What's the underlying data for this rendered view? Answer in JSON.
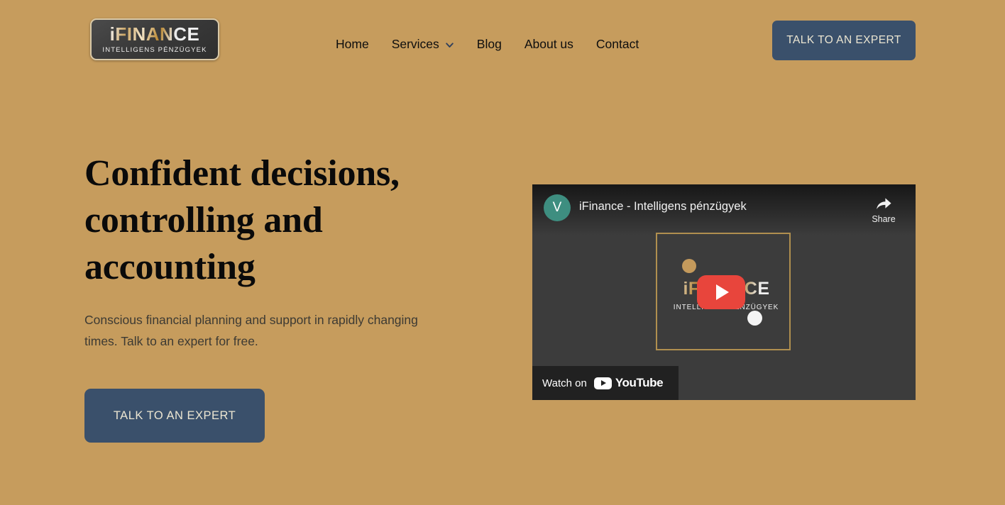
{
  "theme": {
    "background": "#c69c5d",
    "accent_navy": "#3a506b",
    "button_text": "#ece6d2",
    "heading_color": "#0a0a0a",
    "body_text": "#3d3a33",
    "youtube_red": "#e8453c",
    "avatar_teal": "#3e8e80",
    "player_bg": "#3c3c3c",
    "logo_gold": "#b88b3f"
  },
  "header": {
    "logo": {
      "main": "iFINANCE",
      "sub": "INTELLIGENS PÉNZÜGYEK"
    },
    "nav": [
      {
        "label": "Home",
        "has_dropdown": false
      },
      {
        "label": "Services",
        "has_dropdown": true,
        "icon": "chevron-down-icon"
      },
      {
        "label": "Blog",
        "has_dropdown": false
      },
      {
        "label": "About us",
        "has_dropdown": false
      },
      {
        "label": "Contact",
        "has_dropdown": false
      }
    ],
    "cta_label": "TALK TO AN EXPERT"
  },
  "hero": {
    "title": "Confident decisions, controlling and accounting",
    "subtitle": "Conscious financial planning and support in rapidly changing times. Talk to an expert for free.",
    "cta_label": "TALK TO AN EXPERT"
  },
  "video": {
    "channel_initial": "V",
    "title": "iFinance - Intelligens pénzügyek",
    "share_label": "Share",
    "share_icon": "share-arrow-icon",
    "play_icon": "play-button-icon",
    "watch_on_label": "Watch on",
    "platform_name": "YouTube",
    "thumbnail": {
      "brand": "iFINANCE",
      "tagline": "INTELLIGENS PÉNZÜGYEK"
    }
  }
}
